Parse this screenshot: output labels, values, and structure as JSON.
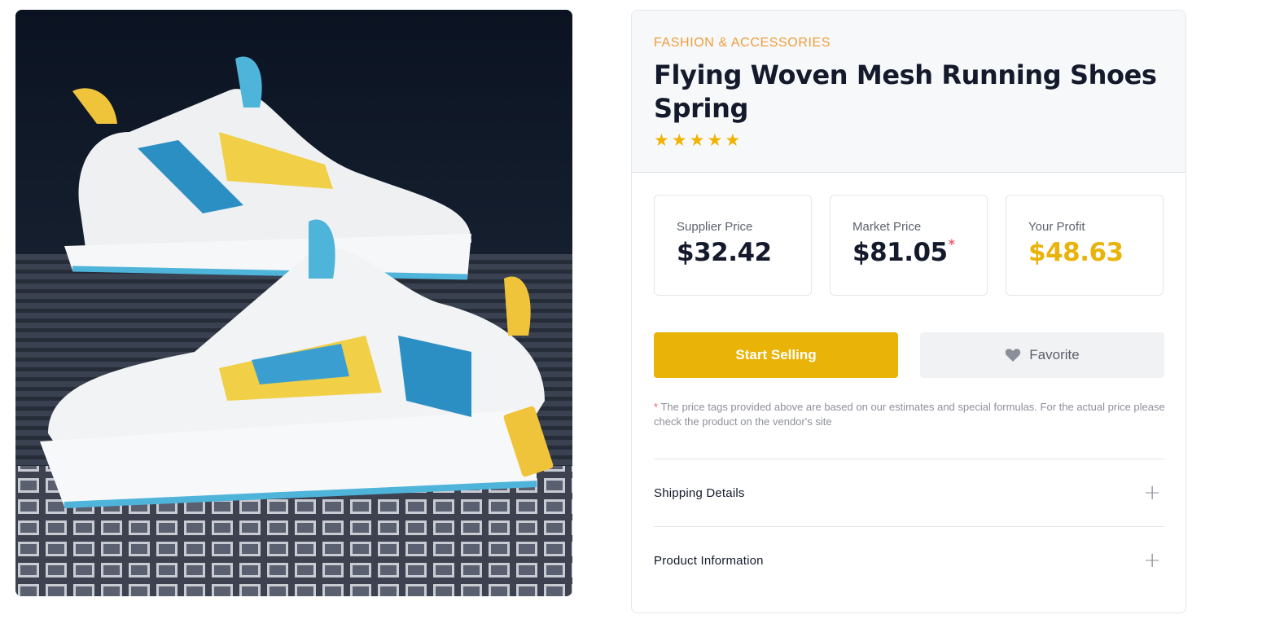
{
  "product": {
    "category": "FASHION & ACCESSORIES",
    "title": "Flying Woven Mesh Running Shoes Spring",
    "rating": 5,
    "star_glyph": "★",
    "image_icon": "product-photo"
  },
  "prices": [
    {
      "label": "Supplier Price",
      "value": "$32.42",
      "asterisk": ""
    },
    {
      "label": "Market Price",
      "value": "$81.05",
      "asterisk": "*"
    },
    {
      "label": "Your Profit",
      "value": "$48.63",
      "asterisk": ""
    }
  ],
  "actions": {
    "start_selling": "Start Selling",
    "favorite": "Favorite",
    "favorite_icon": "heart-icon"
  },
  "disclaimer": {
    "asterisk": "*",
    "text": " The price tags provided above are based on our estimates and special formulas. For the actual price please check the product on the vendor's site"
  },
  "accordion": [
    {
      "label": "Shipping Details",
      "icon": "plus-icon"
    },
    {
      "label": "Product Information",
      "icon": "plus-icon"
    }
  ],
  "colors": {
    "accent": "#eab308",
    "category": "#ef9d3a",
    "star": "#f0b300",
    "profit": "#eab30a",
    "asterisk": "#f35d6e"
  }
}
